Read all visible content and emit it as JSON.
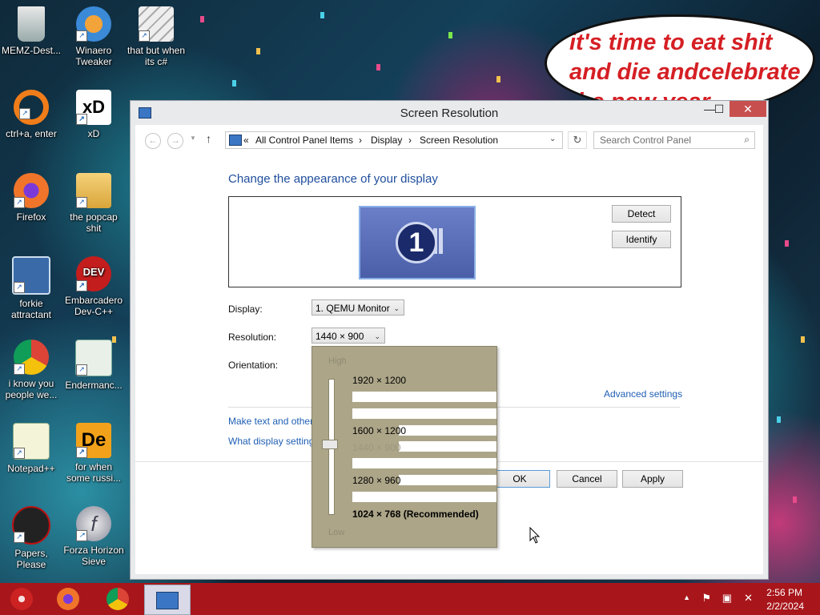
{
  "bubble": {
    "text": "it's time to eat shit and die andcelebrate the new year"
  },
  "desktop_icons": [
    {
      "label": "MEMZ-Dest..."
    },
    {
      "label": "Winaero Tweaker"
    },
    {
      "label": "that but when its c#"
    },
    {
      "label": "ctrl+a, enter"
    },
    {
      "label": "xD"
    },
    {
      "label": "Firefox"
    },
    {
      "label": "the popcap shit"
    },
    {
      "label": "forkie attractant"
    },
    {
      "label": "Embarcadero Dev-C++"
    },
    {
      "label": "i know you people we..."
    },
    {
      "label": "Endermanc..."
    },
    {
      "label": "Notepad++"
    },
    {
      "label": "for when some russi..."
    },
    {
      "label": "Papers, Please"
    },
    {
      "label": "Forza Horizon Sieve"
    }
  ],
  "window": {
    "title": "Screen Resolution",
    "min": "—",
    "max": "☐",
    "close": "✕",
    "breadcrumb": [
      "«",
      "All Control Panel Items",
      "›",
      "Display",
      "›",
      "Screen Resolution"
    ],
    "search_placeholder": "Search Control Panel",
    "heading": "Change the appearance of your display",
    "monitor_number": "1",
    "detect": "Detect",
    "identify": "Identify",
    "display_label": "Display:",
    "display_value": "1. QEMU Monitor",
    "resolution_label": "Resolution:",
    "resolution_value": "1440 × 900",
    "orientation_label": "Orientation:",
    "advanced": "Advanced settings",
    "link1": "Make text and other",
    "link2": "What display setting",
    "ok": "OK",
    "cancel": "Cancel",
    "apply": "Apply"
  },
  "resolution_popup": {
    "high": "High",
    "low": "Low",
    "options": [
      {
        "label": "1920 × 1200"
      },
      {
        "label": "1600 × 1200"
      },
      {
        "label": "1440 × 900"
      },
      {
        "label": "1280 × 960"
      },
      {
        "label": "1024 × 768 (Recommended)"
      }
    ]
  },
  "taskbar": {
    "time": "2:56 PM",
    "date": "2/2/2024"
  }
}
